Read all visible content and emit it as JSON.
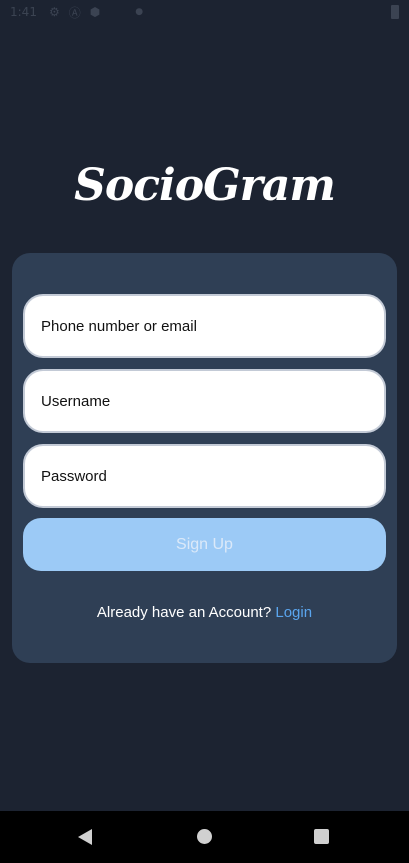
{
  "status_bar": {
    "time": "1:41",
    "icons": [
      "settings-icon",
      "a-icon",
      "shield-icon",
      "dot-icon",
      "battery-icon"
    ]
  },
  "app": {
    "logo": "SocioGram"
  },
  "form": {
    "phone_placeholder": "Phone number or  email",
    "username_placeholder": "Username",
    "password_placeholder": "Password",
    "signup_label": "Sign Up",
    "login_prompt": "Already have an Account?",
    "login_link": "Login"
  },
  "colors": {
    "background": "#1c2331",
    "card": "#2f3f55",
    "button": "#9ccaf6",
    "link": "#5aa5ee"
  },
  "nav_bar": {
    "icons": [
      "back-icon",
      "home-icon",
      "recents-icon"
    ]
  }
}
